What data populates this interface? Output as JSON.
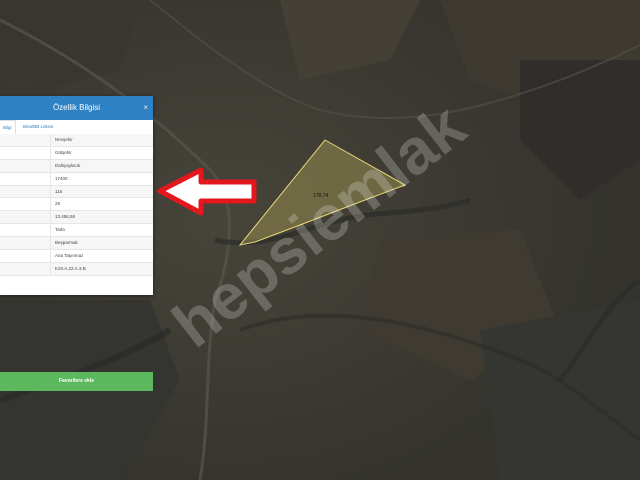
{
  "map": {
    "colors": {
      "base": "#3b3a34",
      "parcel": "#e8d878",
      "arrow": "#e3171d"
    },
    "parcel_label": "178,74",
    "watermark": "hepsiemlak"
  },
  "panel": {
    "title": "Özellik Bilgisi",
    "close": "×",
    "tabs": [
      "Bilgi",
      "Bina/BB Listesi"
    ],
    "rows": [
      "Nevşehir",
      "Gülşehir",
      "Dallıyaylacık",
      "17400",
      "115",
      "29",
      "13.456,58",
      "Tarla",
      "Beşparmak",
      "Ana Taşınmaz",
      "K33.A.22.A.3.B"
    ],
    "button": "Favorilere ekle",
    "colors": {
      "header": "#2e82c3",
      "button": "#5cb85c"
    }
  }
}
